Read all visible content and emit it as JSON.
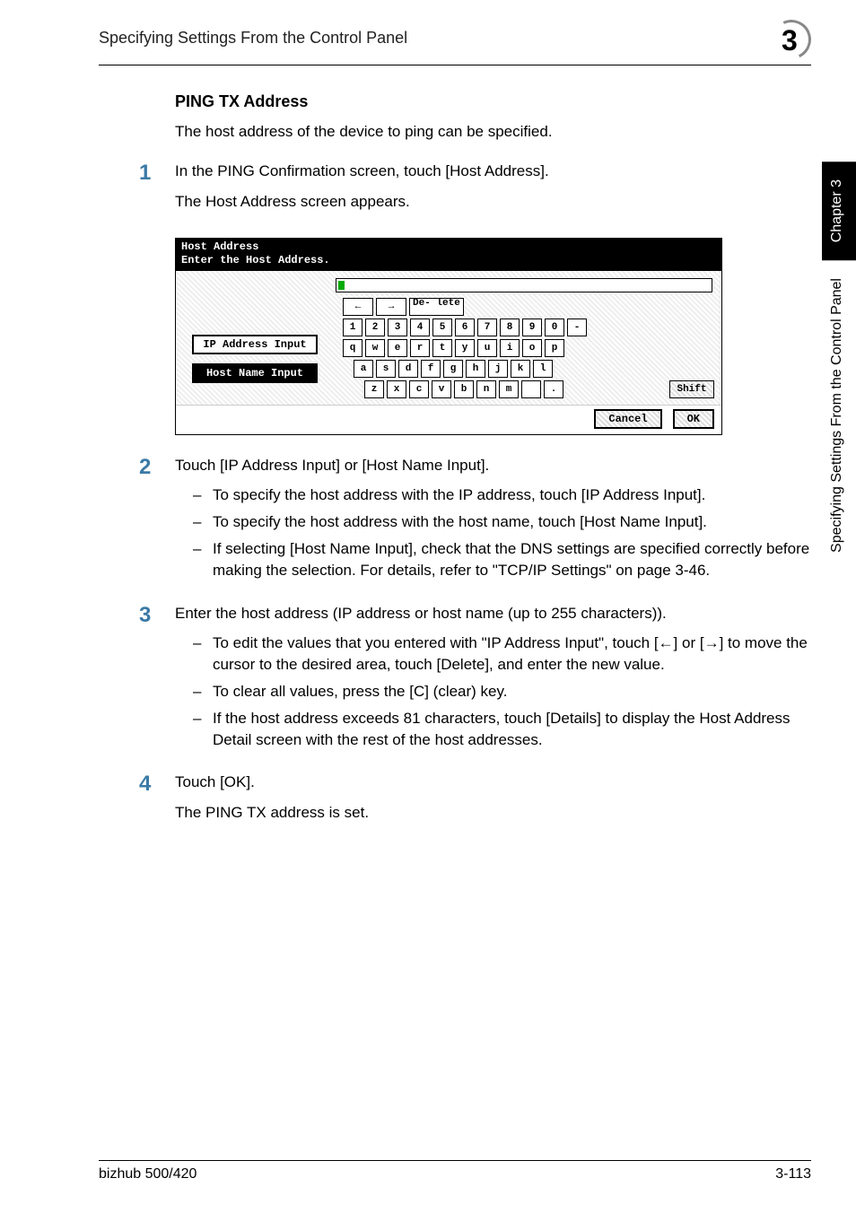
{
  "header": {
    "title": "Specifying Settings From the Control Panel",
    "chapter_number": "3"
  },
  "side_tab": {
    "chapter_label": "Chapter 3",
    "section_label": "Specifying Settings From the Control Panel"
  },
  "section": {
    "heading": "PING TX Address",
    "intro": "The host address of the device to ping can be specified."
  },
  "steps": [
    {
      "num": "1",
      "lines": [
        "In the PING Confirmation screen, touch [Host Address].",
        "The Host Address screen appears."
      ]
    },
    {
      "num": "2",
      "lines": [
        "Touch [IP Address Input] or [Host Name Input]."
      ],
      "bullets": [
        "To specify the host address with the IP address, touch [IP Address Input].",
        "To specify the host address with the host name, touch [Host Name Input].",
        "If selecting [Host Name Input], check that the DNS settings are specified correctly before making the selection. For details, refer to \"TCP/IP Settings\" on page 3-46."
      ]
    },
    {
      "num": "3",
      "lines": [
        "Enter the host address (IP address or host name (up to 255 characters))."
      ],
      "bullets": [
        "To edit the values that you entered with \"IP Address Input\", touch [←] or [→] to move the cursor to the desired area, touch [Delete], and enter the new value.",
        "To clear all values, press the [C] (clear) key.",
        "If the host address exceeds 81 characters, touch [Details] to display the Host Address Detail screen with the rest of the host addresses."
      ]
    },
    {
      "num": "4",
      "lines": [
        "Touch [OK].",
        "The PING TX address is set."
      ]
    }
  ],
  "screenshot": {
    "title_line1": "Host Address",
    "title_line2": "Enter the Host Address.",
    "left_buttons": {
      "ip": "IP Address Input",
      "host": "Host Name Input"
    },
    "nav": {
      "left": "←",
      "right": "→",
      "delete": "De-\nlete"
    },
    "rows": {
      "r1": [
        "1",
        "2",
        "3",
        "4",
        "5",
        "6",
        "7",
        "8",
        "9",
        "0",
        "-"
      ],
      "r2": [
        "q",
        "w",
        "e",
        "r",
        "t",
        "y",
        "u",
        "i",
        "o",
        "p"
      ],
      "r3": [
        "a",
        "s",
        "d",
        "f",
        "g",
        "h",
        "j",
        "k",
        "l"
      ],
      "r4": [
        "z",
        "x",
        "c",
        "v",
        "b",
        "n",
        "m",
        "",
        "."
      ]
    },
    "shift": "Shift",
    "cancel": "Cancel",
    "ok": "OK"
  },
  "footer": {
    "left": "bizhub 500/420",
    "right": "3-113"
  }
}
